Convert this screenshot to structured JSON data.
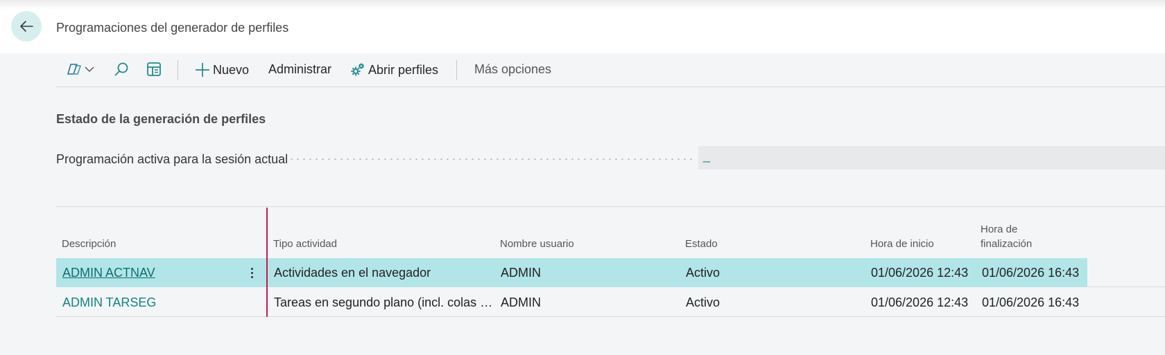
{
  "header": {
    "title": "Programaciones del generador de perfiles",
    "back_icon": "arrow-left-icon"
  },
  "actions": {
    "copilot_icon": "copilot-icon",
    "search_icon": "search-icon",
    "filter_pane_icon": "filter-pane-icon",
    "new_label": "Nuevo",
    "manage_label": "Administrar",
    "open_profiles_label": "Abrir perfiles",
    "more_options_label": "Más opciones"
  },
  "status_section": {
    "title": "Estado de la generación de perfiles",
    "active_schedule_label": "Programación activa para la sesión actual",
    "active_schedule_value": "_"
  },
  "list": {
    "columns": {
      "description": "Descripción",
      "activity_type": "Tipo actividad",
      "user_name": "Nombre usuario",
      "status": "Estado",
      "start_time": "Hora de inicio",
      "end_time_line1": "Hora de",
      "end_time_line2": "finalización"
    },
    "rows": [
      {
        "description": "ADMIN ACTNAV",
        "activity_type": "Actividades en el navegador",
        "user_name": "ADMIN",
        "status": "Activo",
        "start_time": "01/06/2026 12:43",
        "end_time": "01/06/2026 16:43",
        "selected": true
      },
      {
        "description": "ADMIN TARSEG",
        "activity_type": "Tareas en segundo plano (incl. colas de proyectos)",
        "user_name": "ADMIN",
        "status": "Activo",
        "start_time": "01/06/2026 12:43",
        "end_time": "01/06/2026 16:43",
        "selected": false
      }
    ]
  },
  "colors": {
    "accent": "#128484",
    "selected_row": "#b2e5e8",
    "freeze_line": "#c8174a"
  }
}
